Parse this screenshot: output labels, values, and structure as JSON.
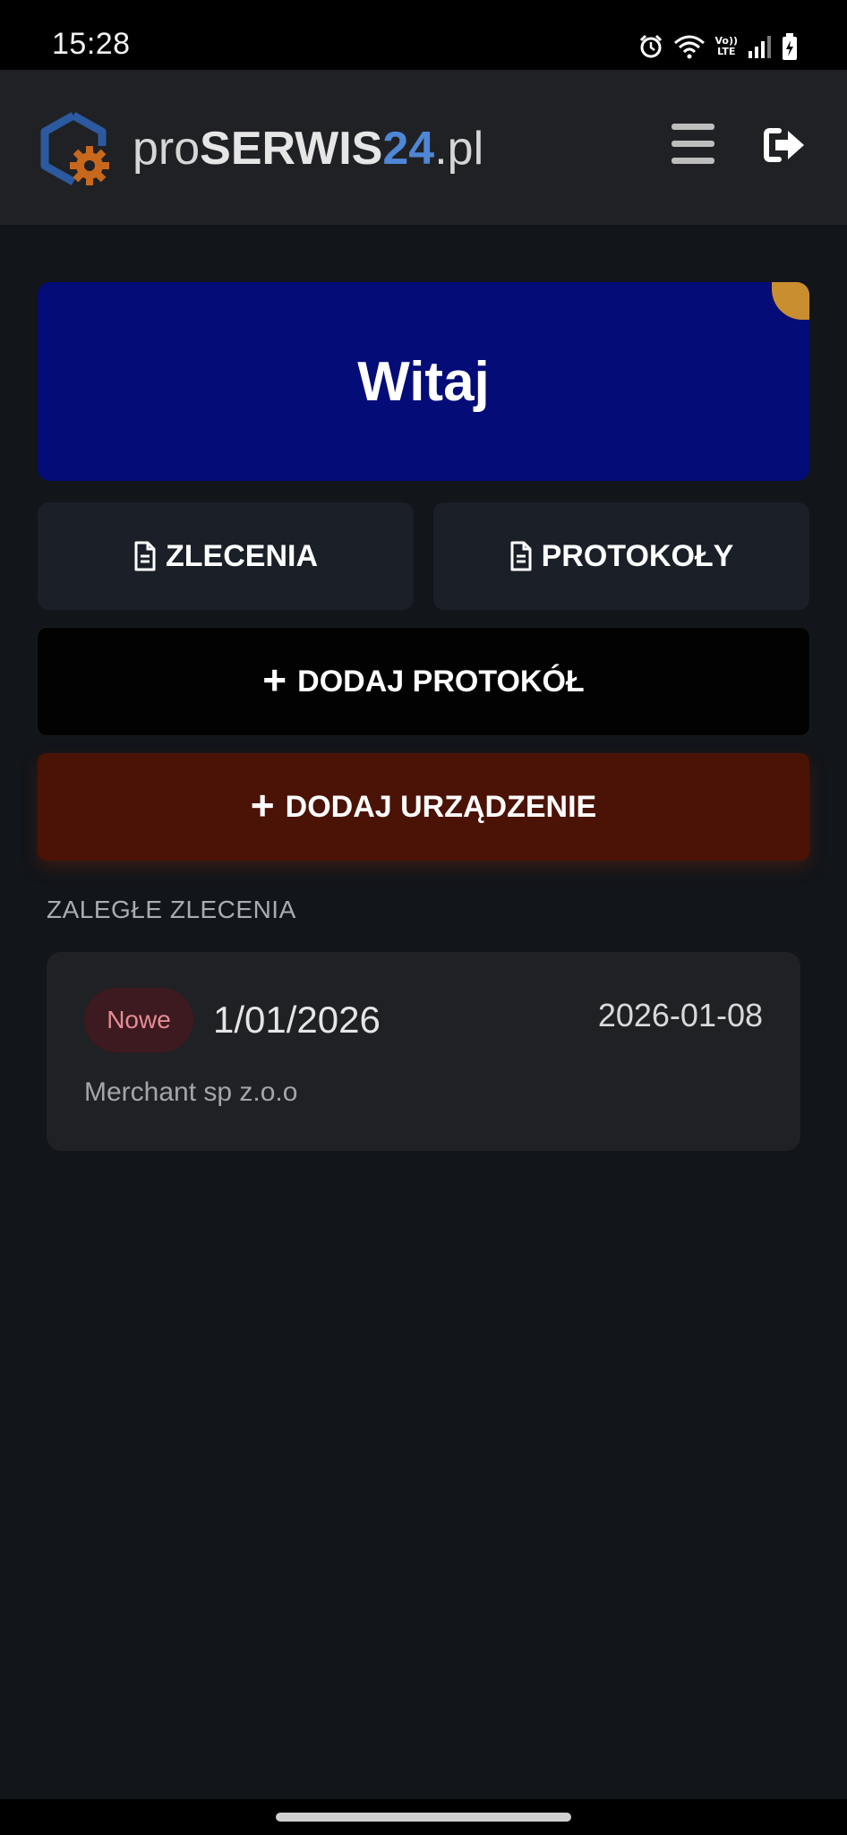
{
  "status_bar": {
    "time": "15:28",
    "network_label_top": "Vo))",
    "network_label_bottom": "LTE",
    "icons": [
      "alarm-icon",
      "wifi-icon",
      "network-lte-icon",
      "signal-icon",
      "battery-charging-icon"
    ]
  },
  "header": {
    "brand_prefix": "pro",
    "brand_main": "SERWIS",
    "brand_number": "24",
    "brand_suffix": ".pl",
    "icons": [
      "logo-hexagon-gear-icon",
      "hamburger-menu-icon",
      "logout-icon"
    ]
  },
  "colors": {
    "background": "#12151a",
    "header": "#1f2124",
    "welcome": "#040c77",
    "accent_gold": "#c98e2f",
    "brand_blue": "#4f86d6",
    "logo_orange": "#c8681c",
    "add_device": "#4b1305",
    "badge_text": "#e58c95"
  },
  "welcome": {
    "title": "Witaj"
  },
  "nav": {
    "orders_label": "ZLECENIA",
    "protocols_label": "PROTOKOŁY",
    "icon": "document-icon"
  },
  "actions": {
    "add_protocol_label": "DODAJ PROTOKÓŁ",
    "add_device_label": "DODAJ URZĄDZENIE",
    "plus_symbol": "+"
  },
  "overdue": {
    "section_title": "ZALEGŁE ZLECENIA",
    "orders": [
      {
        "status": "Nowe",
        "number": "1/01/2026",
        "date": "2026-01-08",
        "client": "Merchant sp z.o.o"
      }
    ]
  }
}
